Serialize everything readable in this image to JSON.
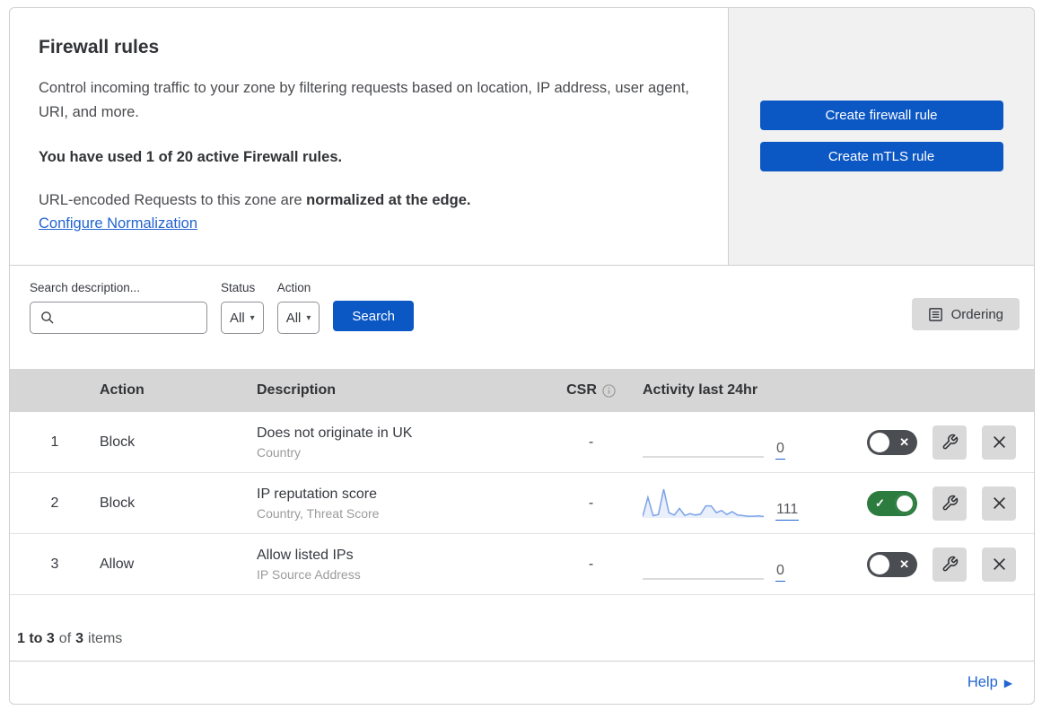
{
  "colors": {
    "primary_blue": "#0b57c4",
    "link_blue": "#2264d1",
    "toggle_on_green": "#2c7c3f",
    "toggle_off_gray": "#4a4d52",
    "sparkline_blue": "#7ba3e8",
    "side_panel_gray": "#f1f1f1",
    "table_header_gray": "#d6d6d6"
  },
  "header": {
    "title": "Firewall rules",
    "description": "Control incoming traffic to your zone by filtering requests based on location, IP address, user agent, URI, and more.",
    "usage_note": "You have used 1 of 20 active Firewall rules.",
    "normalization_text": "URL-encoded Requests to this zone are",
    "normalization_bold": "normalized at the edge.",
    "normalization_link": "Configure Normalization",
    "create_firewall_button": "Create firewall rule",
    "create_mtls_button": "Create mTLS rule"
  },
  "filters": {
    "search_label": "Search description...",
    "status_label": "Status",
    "status_value": "All",
    "action_label": "Action",
    "action_value": "All",
    "search_button": "Search",
    "ordering_button": "Ordering"
  },
  "table": {
    "columns": {
      "action": "Action",
      "description": "Description",
      "csr": "CSR",
      "activity": "Activity last 24hr"
    },
    "rows": [
      {
        "index": "1",
        "action": "Block",
        "title": "Does not originate in UK",
        "subtitle": "Country",
        "csr": "-",
        "activity_count": "0",
        "enabled": false,
        "sparkline_values": null
      },
      {
        "index": "2",
        "action": "Block",
        "title": "IP reputation score",
        "subtitle": "Country, Threat Score",
        "csr": "-",
        "activity_count": "111",
        "enabled": true,
        "sparkline_values": [
          5,
          72,
          8,
          12,
          100,
          18,
          10,
          33,
          8,
          15,
          10,
          13,
          42,
          42,
          18,
          26,
          12,
          22,
          10,
          8,
          6,
          6,
          7,
          5
        ]
      },
      {
        "index": "3",
        "action": "Allow",
        "title": "Allow listed IPs",
        "subtitle": "IP Source Address",
        "csr": "-",
        "activity_count": "0",
        "enabled": false,
        "sparkline_values": null
      }
    ]
  },
  "chart_data": {
    "type": "line",
    "title": "Activity last 24hr sparkline (rule 2: IP reputation score)",
    "x": [
      1,
      2,
      3,
      4,
      5,
      6,
      7,
      8,
      9,
      10,
      11,
      12,
      13,
      14,
      15,
      16,
      17,
      18,
      19,
      20,
      21,
      22,
      23,
      24
    ],
    "values": [
      5,
      72,
      8,
      12,
      100,
      18,
      10,
      33,
      8,
      15,
      10,
      13,
      42,
      42,
      18,
      26,
      12,
      22,
      10,
      8,
      6,
      6,
      7,
      5
    ],
    "total_label": "111",
    "xlabel": "",
    "ylabel": "",
    "grid": false,
    "legend": false
  },
  "footer": {
    "range": "1 to 3",
    "of_word": "of",
    "total": "3",
    "items_word": "items",
    "help_label": "Help"
  },
  "icons": {
    "toggle_check": "✓",
    "toggle_x": "✕",
    "dropdown_caret": "▾",
    "help_arrow": "▶"
  }
}
